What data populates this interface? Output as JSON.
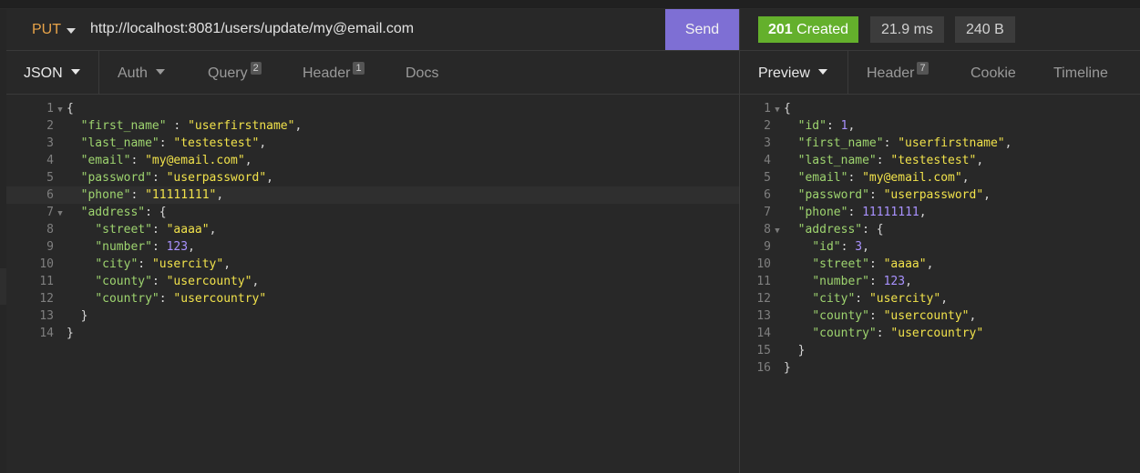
{
  "request": {
    "method": "PUT",
    "url": "http://localhost:8081/users/update/my@email.com",
    "send_label": "Send"
  },
  "request_tabs": [
    {
      "label": "JSON",
      "badge": ""
    },
    {
      "label": "Auth",
      "badge": ""
    },
    {
      "label": "Query",
      "badge": "2"
    },
    {
      "label": "Header",
      "badge": "1"
    },
    {
      "label": "Docs",
      "badge": ""
    }
  ],
  "response": {
    "status_code": "201",
    "status_text": "Created",
    "time": "21.9 ms",
    "size": "240 B"
  },
  "response_tabs": [
    {
      "label": "Preview",
      "badge": ""
    },
    {
      "label": "Header",
      "badge": "7"
    },
    {
      "label": "Cookie",
      "badge": ""
    },
    {
      "label": "Timeline",
      "badge": ""
    }
  ],
  "request_body": [
    [
      [
        "p",
        "{"
      ]
    ],
    [
      [
        "p",
        "  "
      ],
      [
        "k",
        "\"first_name\""
      ],
      [
        "p",
        " : "
      ],
      [
        "s",
        "\"userfirstname\""
      ],
      [
        "p",
        ","
      ]
    ],
    [
      [
        "p",
        "  "
      ],
      [
        "k",
        "\"last_name\""
      ],
      [
        "p",
        ": "
      ],
      [
        "s",
        "\"testestest\""
      ],
      [
        "p",
        ","
      ]
    ],
    [
      [
        "p",
        "  "
      ],
      [
        "k",
        "\"email\""
      ],
      [
        "p",
        ": "
      ],
      [
        "s",
        "\"my@email.com\""
      ],
      [
        "p",
        ","
      ]
    ],
    [
      [
        "p",
        "  "
      ],
      [
        "k",
        "\"password\""
      ],
      [
        "p",
        ": "
      ],
      [
        "s",
        "\"userpassword\""
      ],
      [
        "p",
        ","
      ]
    ],
    [
      [
        "p",
        "  "
      ],
      [
        "k",
        "\"phone\""
      ],
      [
        "p",
        ": "
      ],
      [
        "s",
        "\"11111111\""
      ],
      [
        "p",
        ","
      ]
    ],
    [
      [
        "p",
        "  "
      ],
      [
        "k",
        "\"address\""
      ],
      [
        "p",
        ": {"
      ]
    ],
    [
      [
        "p",
        "    "
      ],
      [
        "k",
        "\"street\""
      ],
      [
        "p",
        ": "
      ],
      [
        "s",
        "\"aaaa\""
      ],
      [
        "p",
        ","
      ]
    ],
    [
      [
        "p",
        "    "
      ],
      [
        "k",
        "\"number\""
      ],
      [
        "p",
        ": "
      ],
      [
        "n",
        "123"
      ],
      [
        "p",
        ","
      ]
    ],
    [
      [
        "p",
        "    "
      ],
      [
        "k",
        "\"city\""
      ],
      [
        "p",
        ": "
      ],
      [
        "s",
        "\"usercity\""
      ],
      [
        "p",
        ","
      ]
    ],
    [
      [
        "p",
        "    "
      ],
      [
        "k",
        "\"county\""
      ],
      [
        "p",
        ": "
      ],
      [
        "s",
        "\"usercounty\""
      ],
      [
        "p",
        ","
      ]
    ],
    [
      [
        "p",
        "    "
      ],
      [
        "k",
        "\"country\""
      ],
      [
        "p",
        ": "
      ],
      [
        "s",
        "\"usercountry\""
      ]
    ],
    [
      [
        "p",
        "  }"
      ]
    ],
    [
      [
        "p",
        "}"
      ]
    ]
  ],
  "response_body": [
    [
      [
        "p",
        "{"
      ]
    ],
    [
      [
        "p",
        "  "
      ],
      [
        "k",
        "\"id\""
      ],
      [
        "p",
        ": "
      ],
      [
        "n",
        "1"
      ],
      [
        "p",
        ","
      ]
    ],
    [
      [
        "p",
        "  "
      ],
      [
        "k",
        "\"first_name\""
      ],
      [
        "p",
        ": "
      ],
      [
        "s",
        "\"userfirstname\""
      ],
      [
        "p",
        ","
      ]
    ],
    [
      [
        "p",
        "  "
      ],
      [
        "k",
        "\"last_name\""
      ],
      [
        "p",
        ": "
      ],
      [
        "s",
        "\"testestest\""
      ],
      [
        "p",
        ","
      ]
    ],
    [
      [
        "p",
        "  "
      ],
      [
        "k",
        "\"email\""
      ],
      [
        "p",
        ": "
      ],
      [
        "s",
        "\"my@email.com\""
      ],
      [
        "p",
        ","
      ]
    ],
    [
      [
        "p",
        "  "
      ],
      [
        "k",
        "\"password\""
      ],
      [
        "p",
        ": "
      ],
      [
        "s",
        "\"userpassword\""
      ],
      [
        "p",
        ","
      ]
    ],
    [
      [
        "p",
        "  "
      ],
      [
        "k",
        "\"phone\""
      ],
      [
        "p",
        ": "
      ],
      [
        "n",
        "11111111"
      ],
      [
        "p",
        ","
      ]
    ],
    [
      [
        "p",
        "  "
      ],
      [
        "k",
        "\"address\""
      ],
      [
        "p",
        ": {"
      ]
    ],
    [
      [
        "p",
        "    "
      ],
      [
        "k",
        "\"id\""
      ],
      [
        "p",
        ": "
      ],
      [
        "n",
        "3"
      ],
      [
        "p",
        ","
      ]
    ],
    [
      [
        "p",
        "    "
      ],
      [
        "k",
        "\"street\""
      ],
      [
        "p",
        ": "
      ],
      [
        "s",
        "\"aaaa\""
      ],
      [
        "p",
        ","
      ]
    ],
    [
      [
        "p",
        "    "
      ],
      [
        "k",
        "\"number\""
      ],
      [
        "p",
        ": "
      ],
      [
        "n",
        "123"
      ],
      [
        "p",
        ","
      ]
    ],
    [
      [
        "p",
        "    "
      ],
      [
        "k",
        "\"city\""
      ],
      [
        "p",
        ": "
      ],
      [
        "s",
        "\"usercity\""
      ],
      [
        "p",
        ","
      ]
    ],
    [
      [
        "p",
        "    "
      ],
      [
        "k",
        "\"county\""
      ],
      [
        "p",
        ": "
      ],
      [
        "s",
        "\"usercounty\""
      ],
      [
        "p",
        ","
      ]
    ],
    [
      [
        "p",
        "    "
      ],
      [
        "k",
        "\"country\""
      ],
      [
        "p",
        ": "
      ],
      [
        "s",
        "\"usercountry\""
      ]
    ],
    [
      [
        "p",
        "  }"
      ]
    ],
    [
      [
        "p",
        "}"
      ]
    ]
  ]
}
